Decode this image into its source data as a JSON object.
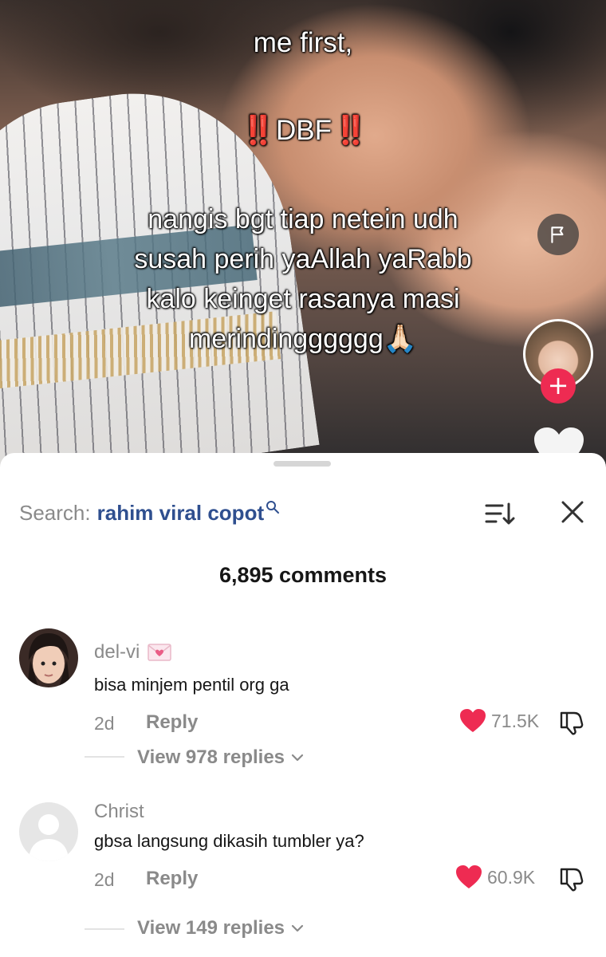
{
  "video": {
    "caption_line1": "me first,",
    "caption_marks": "‼️",
    "caption_line2": "DBF",
    "caption_line3": "nangis bgt tiap netein udh",
    "caption_line4": "susah perih yaAllah yaRabb",
    "caption_line5": "kalo keinget rasanya masi",
    "caption_line6": "merindingggggg",
    "caption_emoji": "🙏🏻",
    "accent_color": "#ee2b52"
  },
  "search": {
    "label": "Search:",
    "query": "rahim viral copot"
  },
  "comments_header": {
    "count": "6,895 comments"
  },
  "comments": [
    {
      "username": "del-vi",
      "badge_icon": "love-letter-icon",
      "text": "bisa minjem pentil org ga",
      "time": "2d",
      "reply_label": "Reply",
      "likes": "71.5K",
      "liked": true,
      "view_replies": "View 978 replies"
    },
    {
      "username": "Christ",
      "text": "gbsa langsung dikasih tumbler ya?",
      "time": "2d",
      "reply_label": "Reply",
      "likes": "60.9K",
      "liked": true,
      "view_replies": "View 149 replies"
    }
  ]
}
